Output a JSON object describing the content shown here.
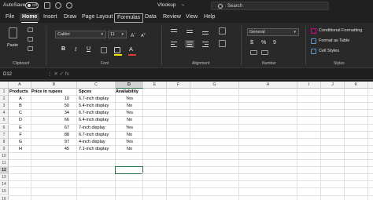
{
  "titlebar": {
    "autosave_label": "AutoSave",
    "autosave_state": "Off",
    "doc_title": "Vlookup",
    "doc_chevron": "⌄",
    "search_placeholder": "Search"
  },
  "tabs": [
    "File",
    "Home",
    "Insert",
    "Draw",
    "Page Layout",
    "Formulas",
    "Data",
    "Review",
    "View",
    "Help"
  ],
  "active_tab": "Home",
  "ribbon": {
    "clipboard": {
      "paste_label": "Paste",
      "group_label": "Clipboard"
    },
    "font": {
      "font_name": "Calibri",
      "font_size": "11",
      "group_label": "Font"
    },
    "alignment": {
      "group_label": "Alignment"
    },
    "number": {
      "format": "General",
      "symbol": "$",
      "percent": "%",
      "comma": "9",
      "group_label": "Number"
    },
    "styles": {
      "conditional_formatting": "Conditional Formatting",
      "format_as_table": "Format as Table",
      "cell_styles": "Cell Styles",
      "group_label": "Styles"
    }
  },
  "formula_bar": {
    "name_box": "D12",
    "icons": "⋮  ✕  ✓  fx",
    "value": ""
  },
  "accent_color": "#217346",
  "grid": {
    "columns": [
      "A",
      "B",
      "C",
      "D",
      "E",
      "F",
      "G",
      "H",
      "I",
      "J",
      "K",
      "L"
    ],
    "rows": [
      "1",
      "2",
      "3",
      "4",
      "5",
      "6",
      "7",
      "8",
      "9",
      "10",
      "11",
      "12",
      "13",
      "14",
      "15",
      "16"
    ],
    "selected_column": "D",
    "selected_row": "12",
    "headers": [
      "Products",
      "Price in rupees",
      "Spces",
      "Availability"
    ],
    "data": [
      [
        "A",
        "10",
        "6.7-inch display",
        "Yes"
      ],
      [
        "B",
        "50",
        "5.4-inch display",
        "No"
      ],
      [
        "C",
        "34",
        "6.7-inch display",
        "Yes"
      ],
      [
        "D",
        "66",
        "6.4-inch display",
        "No"
      ],
      [
        "E",
        "67",
        "7-inch display",
        "Yes"
      ],
      [
        "F",
        "88",
        "6.7-inch display",
        "No"
      ],
      [
        "G",
        "97",
        "4-inch display",
        "Yes"
      ],
      [
        "H",
        "45",
        "7.1-inch display",
        "No"
      ]
    ]
  }
}
